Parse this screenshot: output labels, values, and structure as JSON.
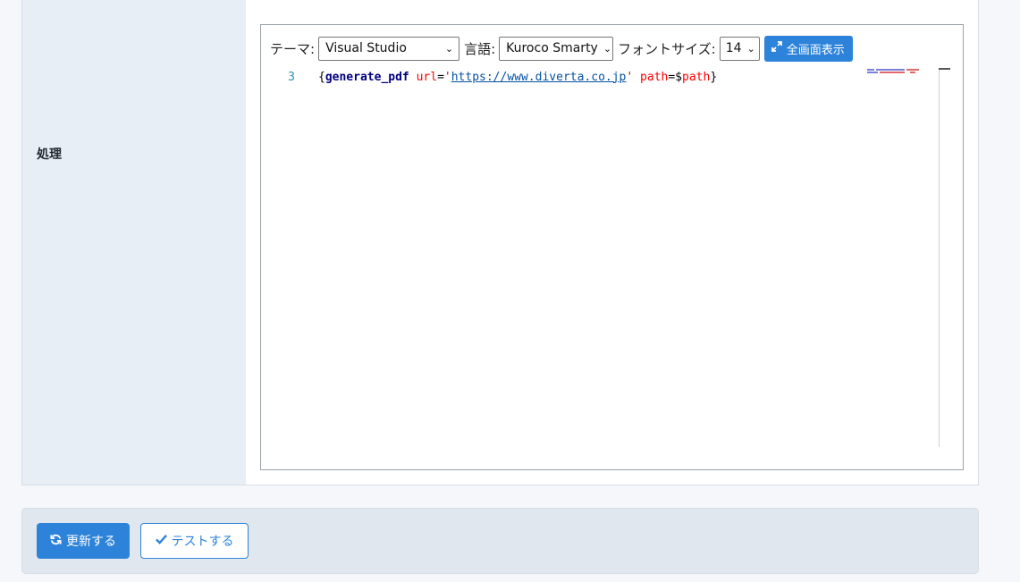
{
  "form_row": {
    "label": "処理"
  },
  "editor": {
    "toolbar": {
      "theme_label": "テーマ:",
      "theme_value": "Visual Studio",
      "language_label": "言語:",
      "language_value": "Kuroco Smarty",
      "font_size_label": "フォントサイズ:",
      "font_size_value": "14",
      "fullscreen_button": "全画面表示",
      "fullscreen_icon": "expand-icon"
    },
    "code": {
      "line_number": "3",
      "tokens": {
        "open_brace": "{",
        "tag": "generate_pdf",
        "attr_url": "url",
        "eq1": "=",
        "quote_open": "'",
        "url": "https://www.diverta.co.jp",
        "quote_close": "'",
        "attr_path": "path",
        "eq2": "=$",
        "var_path": "path",
        "close_brace": "}"
      }
    }
  },
  "actions": {
    "update_button": "更新する",
    "update_icon": "refresh-icon",
    "test_button": "テストする",
    "test_icon": "check-icon"
  },
  "colors": {
    "primary": "#2d83d9",
    "label_bg": "#e8eef6",
    "panel_bg": "#e1e7ef"
  }
}
